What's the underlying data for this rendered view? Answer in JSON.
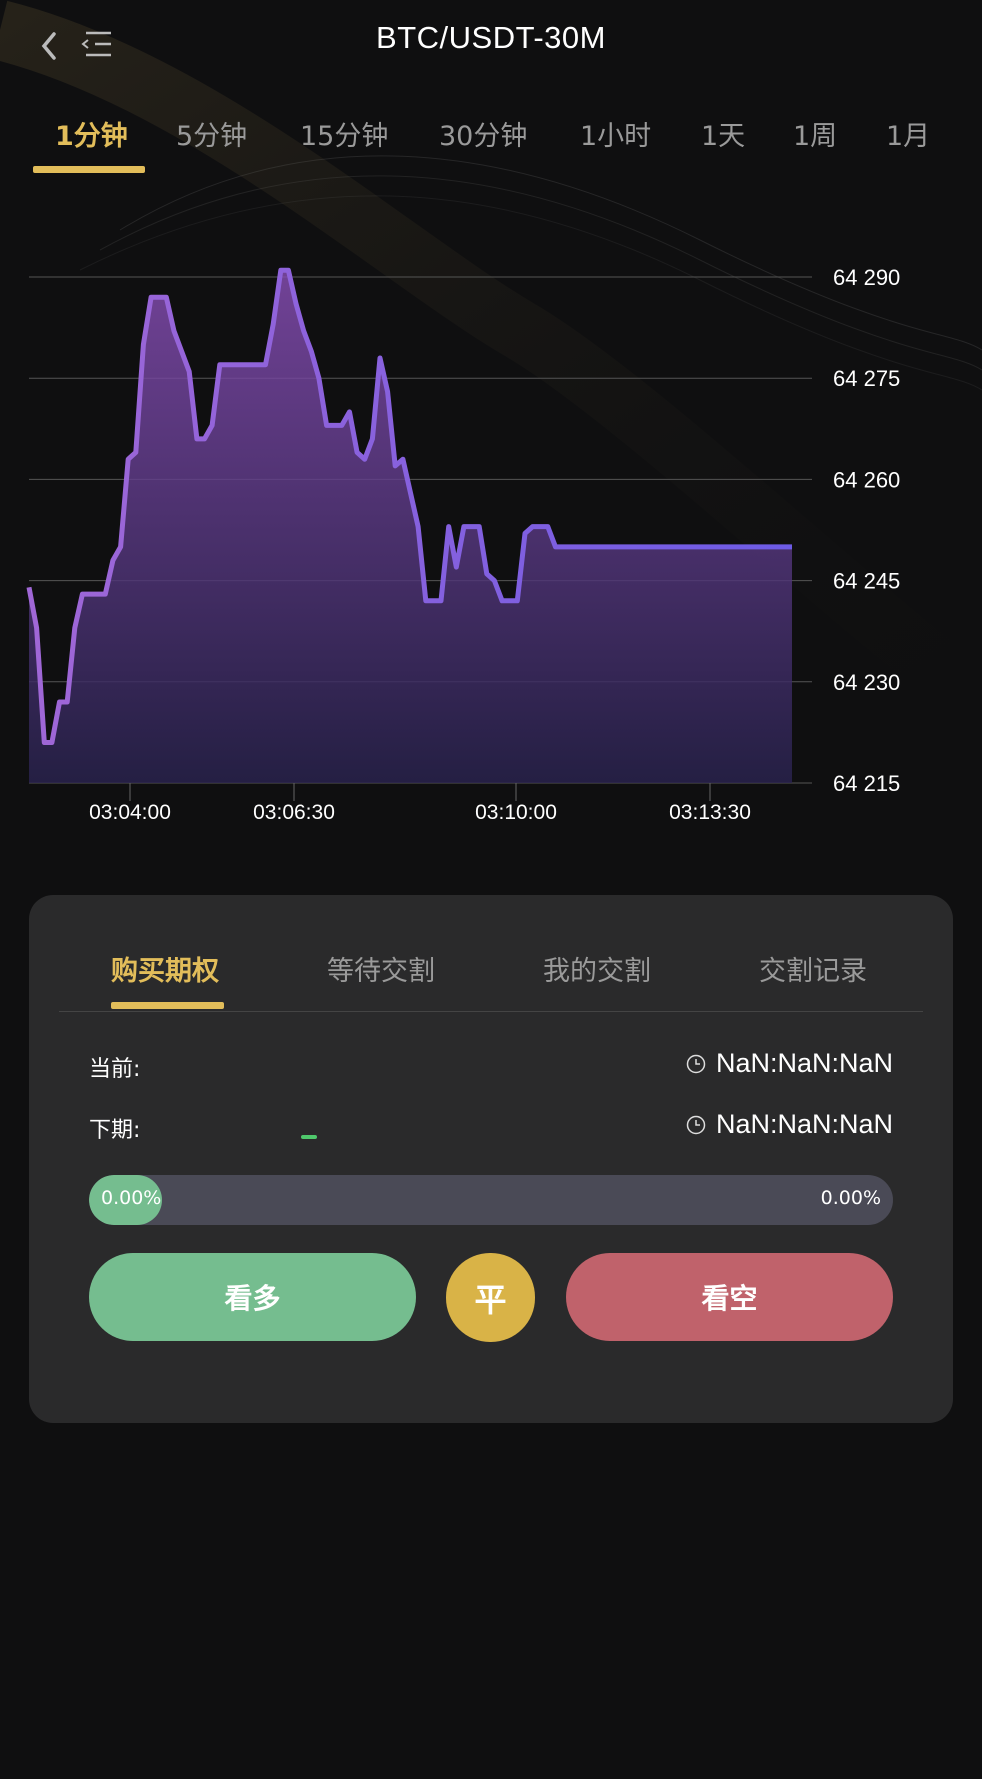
{
  "header": {
    "title": "BTC/USDT-30M"
  },
  "interval_tabs": [
    {
      "label": "1分钟",
      "active": true
    },
    {
      "label": "5分钟",
      "active": false
    },
    {
      "label": "15分钟",
      "active": false
    },
    {
      "label": "30分钟",
      "active": false
    },
    {
      "label": "1小时",
      "active": false
    },
    {
      "label": "1天",
      "active": false
    },
    {
      "label": "1周",
      "active": false
    },
    {
      "label": "1月",
      "active": false
    }
  ],
  "chart_data": {
    "type": "area",
    "title": "",
    "xlabel": "",
    "ylabel": "",
    "y_ticks": [
      "64 290",
      "64 275",
      "64 260",
      "64 245",
      "64 230",
      "64 215"
    ],
    "x_ticks": [
      "03:04:00",
      "03:06:30",
      "03:10:00",
      "03:13:30"
    ],
    "ylim": [
      64215,
      64290
    ],
    "grid": true,
    "line_color_start": "#a067d6",
    "line_color_end": "#6d5be6",
    "x": [
      0,
      1,
      2,
      3,
      4,
      5,
      6,
      7,
      8,
      9,
      10,
      11,
      12,
      13,
      14,
      15,
      16,
      17,
      18,
      19,
      20,
      21,
      22,
      23,
      24,
      25,
      26,
      27,
      28,
      29,
      30,
      31,
      32,
      33,
      34,
      35,
      36,
      37,
      38,
      39,
      40,
      41,
      42,
      43,
      44,
      45,
      46,
      47,
      48,
      49,
      50,
      51,
      52,
      53,
      54,
      55,
      56,
      57,
      58,
      59,
      60,
      61,
      62,
      63,
      64,
      65,
      66,
      67,
      68,
      69,
      70,
      71,
      72,
      73,
      74,
      75,
      76,
      77,
      78,
      79,
      80,
      81,
      82,
      83,
      84,
      85,
      86,
      87,
      88,
      89,
      90,
      91,
      92,
      93,
      94,
      95,
      96,
      97,
      98,
      99,
      100
    ],
    "values": [
      64244,
      64238,
      64221,
      64221,
      64227,
      64227,
      64238,
      64243,
      64243,
      64243,
      64243,
      64248,
      64250,
      64263,
      64264,
      64280,
      64287,
      64287,
      64287,
      64282,
      64279,
      64276,
      64266,
      64266,
      64268,
      64277,
      64277,
      64277,
      64277,
      64277,
      64277,
      64277,
      64283,
      64291,
      64291,
      64286,
      64282,
      64279,
      64275,
      64268,
      64268,
      64268,
      64270,
      64264,
      64263,
      64266,
      64278,
      64273,
      64262,
      64263,
      64258,
      64253,
      64242,
      64242,
      64242,
      64253,
      64247,
      64253,
      64253,
      64253,
      64246,
      64245,
      64242,
      64242,
      64242,
      64252,
      64253,
      64253,
      64253,
      64250,
      64250,
      64250,
      64250,
      64250,
      64250,
      64250,
      64250,
      64250,
      64250,
      64250,
      64250,
      64250,
      64250,
      64250,
      64250,
      64250,
      64250,
      64250,
      64250,
      64250,
      64250,
      64250,
      64250,
      64250,
      64250,
      64250,
      64250,
      64250,
      64250,
      64250,
      64250
    ]
  },
  "panel": {
    "tabs": [
      {
        "label": "购买期权",
        "active": true
      },
      {
        "label": "等待交割",
        "active": false
      },
      {
        "label": "我的交割",
        "active": false
      },
      {
        "label": "交割记录",
        "active": false
      }
    ],
    "current_label": "当前:",
    "current_time": "NaN:NaN:NaN",
    "next_label": "下期:",
    "next_time": "NaN:NaN:NaN",
    "long_percent_text": "0.00%",
    "short_percent_text": "0.00%",
    "long_fraction": 0,
    "buttons": {
      "long": "看多",
      "flat": "平",
      "short": "看空"
    },
    "colors": {
      "accent": "#e2bd5a",
      "long": "#75bd8f",
      "flat": "#d9b347",
      "short": "#c0626b"
    }
  }
}
